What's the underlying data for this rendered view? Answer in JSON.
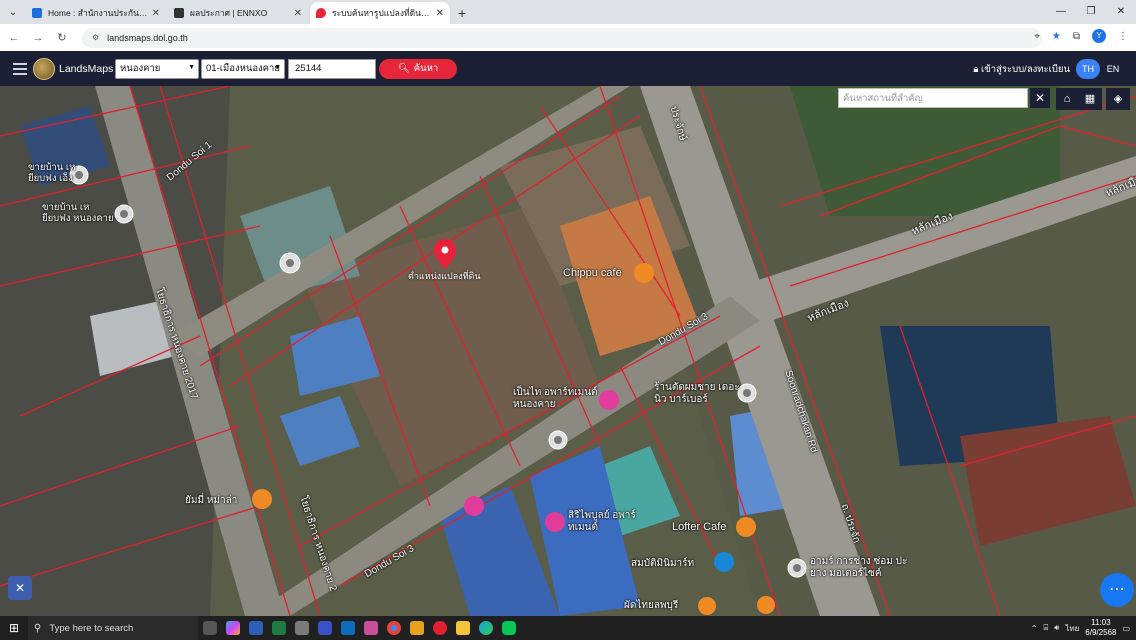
{
  "browser": {
    "tabs": [
      {
        "title": "Home : สำนักงานประกันสังคม",
        "color": "#1e6fd9"
      },
      {
        "title": "ผลประกาศ | ENNXO",
        "color": "#333333"
      },
      {
        "title": "ระบบค้นหารูปแปลงที่ดิน (LandsMaps)",
        "color": "#e6273b"
      }
    ],
    "url": "landsmaps.dol.go.th",
    "new_tab_glyph": "+"
  },
  "app": {
    "brand": "LandsMaps",
    "province": "หนองคาย",
    "district": "01-เมืองหนองคาย",
    "parcel_no": "25144",
    "search_label": "ค้นหา",
    "login_label": "เข้าสู่ระบบ/ลงทะเบียน",
    "lang_th": "TH",
    "lang_en": "EN",
    "accent": "#e6273b",
    "toolbar_bg": "#1c2034"
  },
  "map": {
    "search_placeholder": "ค้นหาสถานที่สำคัญ",
    "pin_label": "ตำแหน่งแปลงที่ดิน",
    "labels": {
      "dondu_soi1": "Dondu Soi 1",
      "nongkhai_2017": "โยธาธิการ หนองคาย 2017",
      "sell_house1": "ขายบ้าน เหยียบฟง เอ็ง",
      "sell_house2": "ขายบ้าน เหยียบฟง หนองคาย",
      "chippu": "Chippu cafe",
      "dondu_soi3": "Dondu Soi 3",
      "dondu_soi3_b": "Dondu Soi 3",
      "apartment": "เป็นไท อพาร์ทเมนต์ หนองคาย",
      "barber": "ร้านตัดผมชาย เดอะนิว บาร์เบอร์",
      "soonrad": "Soonradchakan Rd",
      "lak_mueang1": "หลักเมือง",
      "lak_mueang2": "หลักเมือง",
      "lak_mueang3": "หลักเมือง",
      "prachak": "ประจักษ์",
      "lofter": "Lofter Cafe",
      "siri": "สิริไพบูลย์ อพาร์ทเมนต์",
      "sombat": "สมบัติมินิมาร์ท",
      "arm": "อามร์ การช่าง ซ่อม ปะยาง มอเตอร์ไซค์",
      "yummy": "ยัมมี่ หม่าล่า",
      "pad_thai": "ผัดไทยลพบุรี",
      "nongkhai_2": "โยธาธิการ หนองคาย 2",
      "prachak_rd": "ถ. ประจัก"
    }
  },
  "taskbar": {
    "search_placeholder": "Type here to search",
    "time": "11:03",
    "date": "6/9/2568"
  }
}
